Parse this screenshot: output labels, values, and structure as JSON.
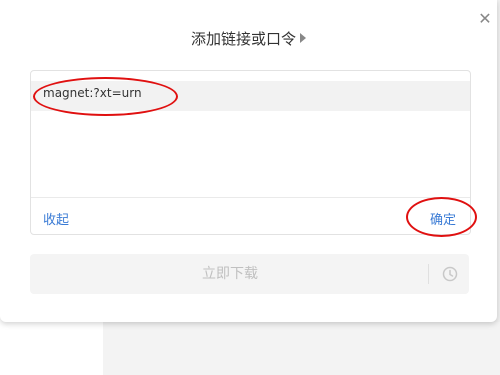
{
  "dialog": {
    "title": "添加链接或口令",
    "link_value": "magnet:?xt=urn",
    "collapse_label": "收起",
    "confirm_label": "确定",
    "download_label": "立即下载"
  },
  "icons": {
    "close": "close-icon",
    "title_arrow": "triangle-right-icon",
    "schedule": "clock-icon",
    "menu": "more-dots-icon"
  },
  "colors": {
    "accent": "#3a7bd5",
    "annotation": "#e01010",
    "disabled_text": "#c0c0c0"
  }
}
